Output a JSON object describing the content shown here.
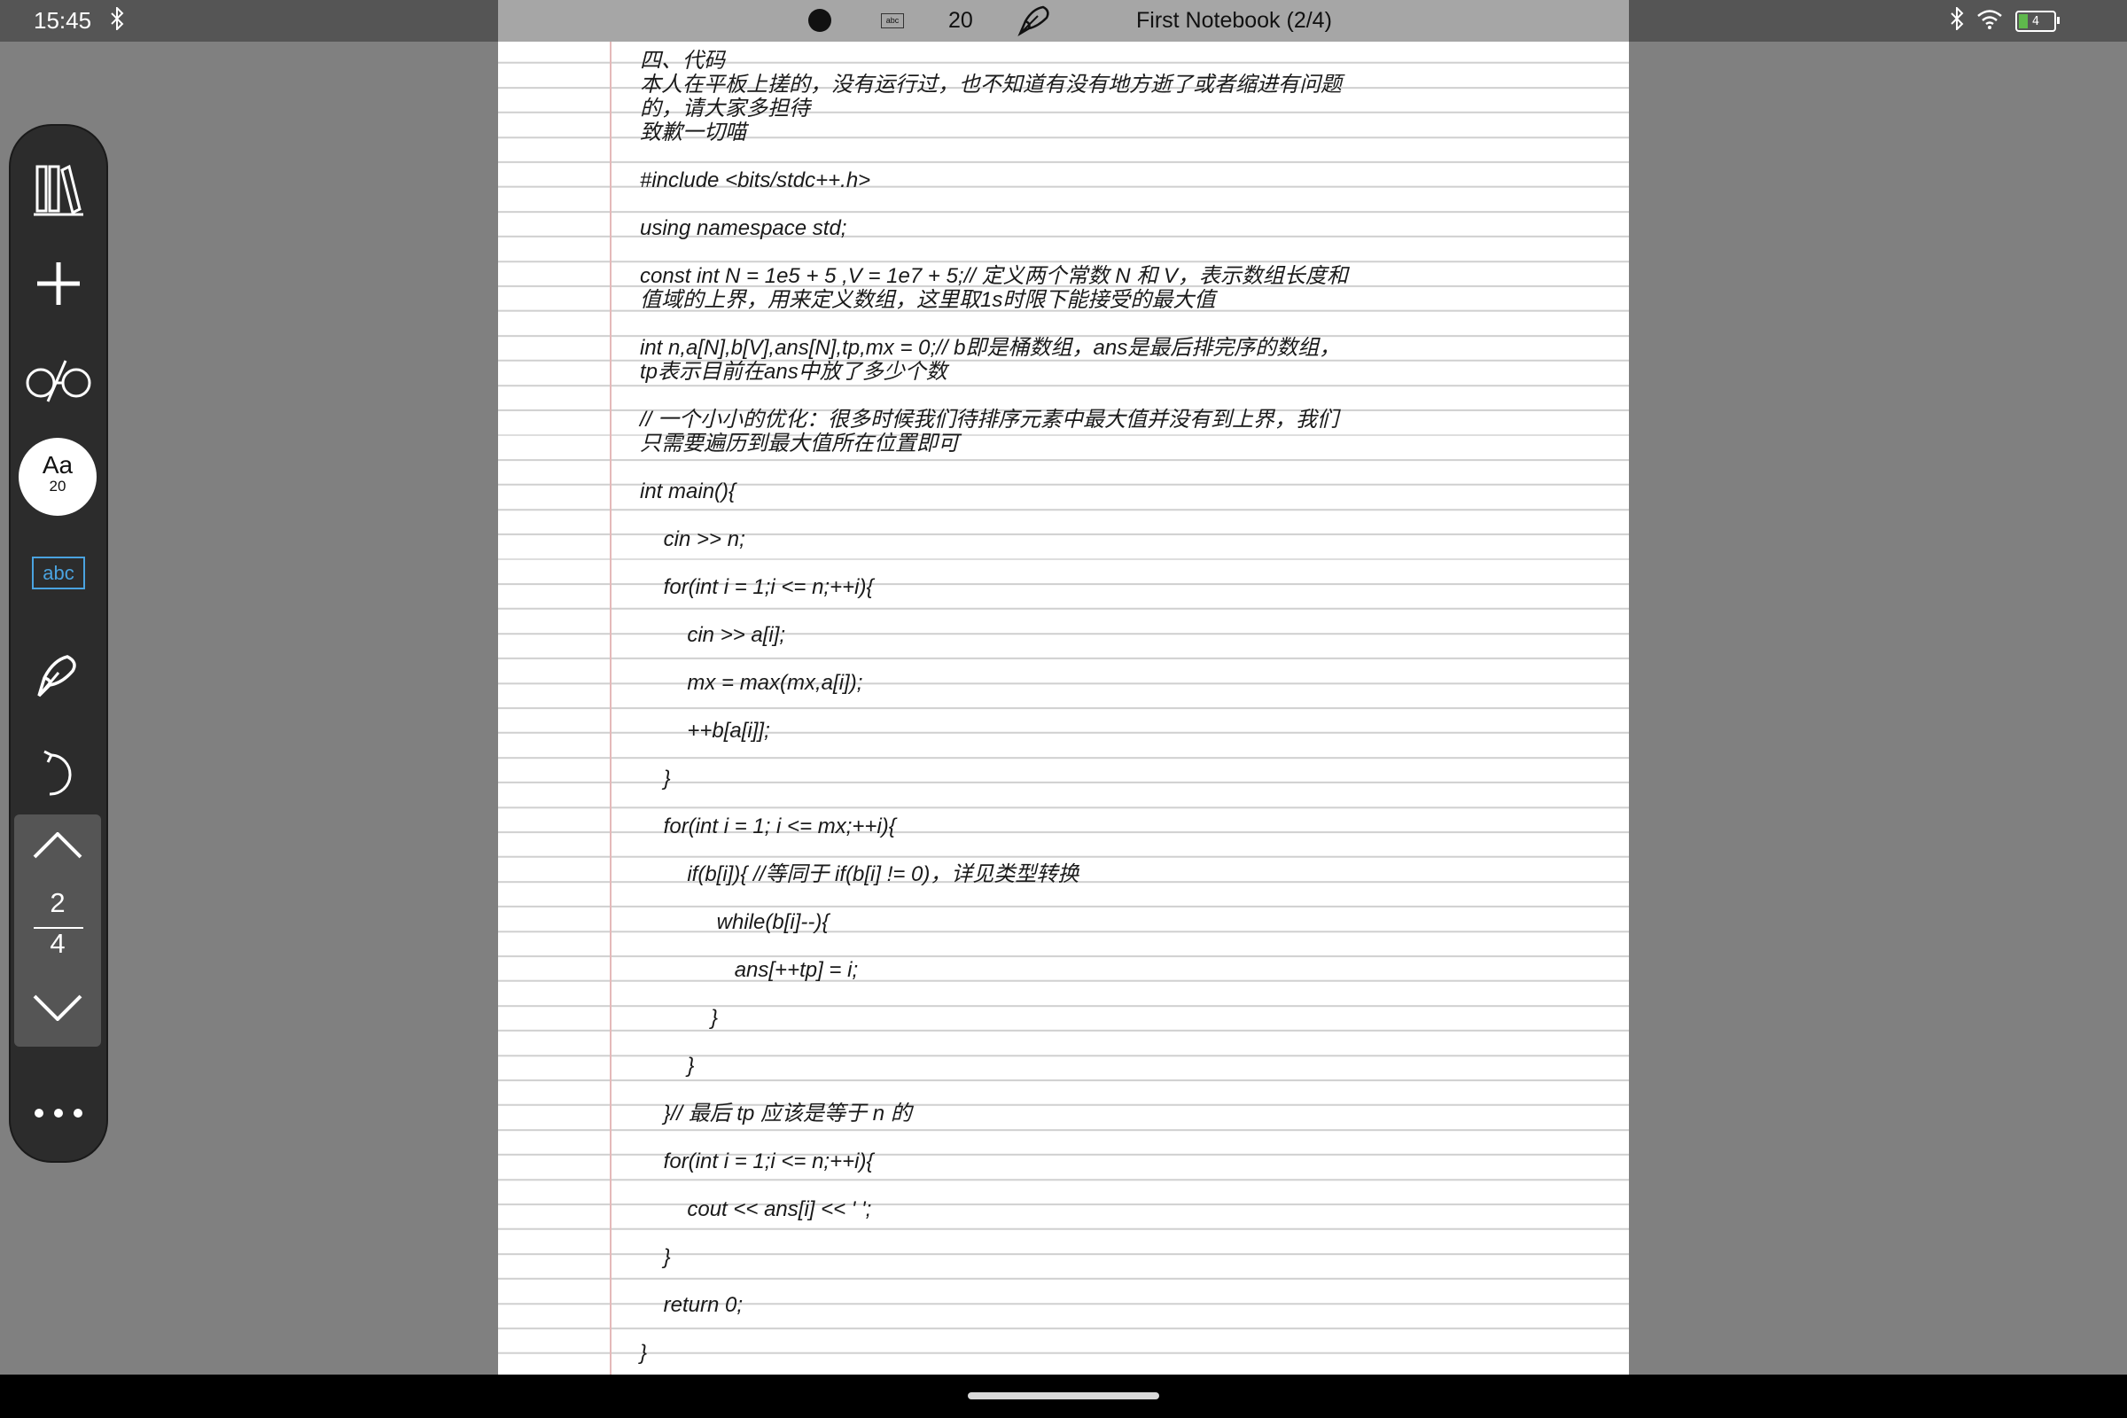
{
  "status": {
    "time": "15:45",
    "battery_level": "4",
    "icons": [
      "bluetooth-icon",
      "wifi-icon",
      "battery-charging-icon"
    ]
  },
  "header": {
    "pen_size": "20",
    "title": "First Notebook (2/4)",
    "abc_label": "abc"
  },
  "toolbar": {
    "font_label": "Aa",
    "font_size": "20",
    "abc_label": "abc",
    "page_current": "2",
    "page_total": "4",
    "more_label": "•••"
  },
  "colors": {
    "accent": "#4aa3e0",
    "battery_green": "#5fb84c",
    "margin_red": "#e4b9b9"
  },
  "notebook": {
    "lines": [
      "四、代码",
      "本人在平板上搓的，没有运行过，也不知道有没有地方逝了或者缩进有问题",
      "的，请大家多担待",
      "致歉一切喵",
      "",
      "#include <bits/stdc++.h>",
      "",
      "using namespace std;",
      "",
      "const int N = 1e5 + 5 ,V = 1e7 + 5;// 定义两个常数 N 和 V，表示数组长度和",
      "值域的上界，用来定义数组，这里取1s时限下能接受的最大值",
      "",
      "int n,a[N],b[V],ans[N],tp,mx = 0;// b即是桶数组，ans是最后排完序的数组，",
      "tp表示目前在ans中放了多少个数",
      "",
      "// 一个小小的优化：很多时候我们待排序元素中最大值并没有到上界，我们",
      "只需要遍历到最大值所在位置即可",
      "",
      "int main(){",
      "",
      "    cin >> n;",
      "",
      "    for(int i = 1;i <= n;++i){",
      "",
      "        cin >> a[i];",
      "",
      "        mx = max(mx,a[i]);",
      "",
      "        ++b[a[i]];",
      "",
      "    }",
      "",
      "    for(int i = 1; i <= mx;++i){",
      "",
      "        if(b[i]){ //等同于 if(b[i] != 0)，详见类型转换",
      "",
      "             while(b[i]--){",
      "",
      "                ans[++tp] = i;",
      "",
      "            }",
      "",
      "        }",
      "",
      "    }// 最后 tp 应该是等于 n 的",
      "",
      "    for(int i = 1;i <= n;++i){",
      "",
      "        cout << ans[i] << ' ';",
      "",
      "    }",
      "",
      "    return 0;",
      "",
      "}"
    ]
  }
}
